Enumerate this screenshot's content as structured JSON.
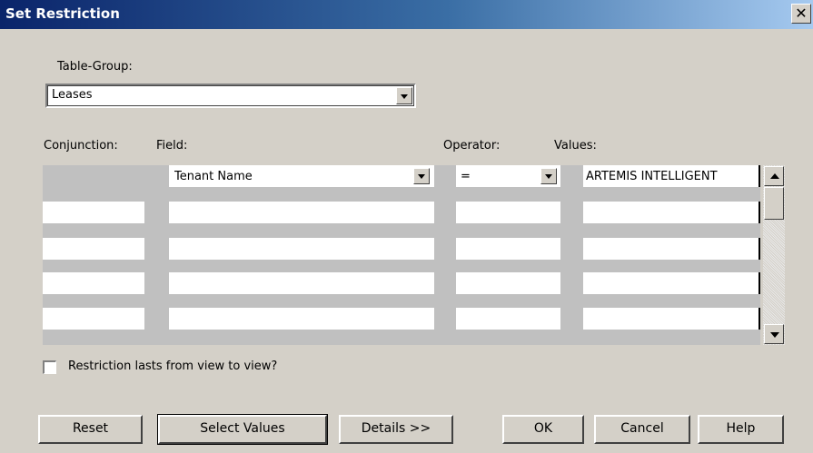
{
  "window": {
    "title": "Set Restriction",
    "close_glyph": "✕"
  },
  "table_group": {
    "label": "Table-Group:",
    "value": "Leases"
  },
  "columns": {
    "conjunction": "Conjunction:",
    "field": "Field:",
    "operator": "Operator:",
    "values": "Values:"
  },
  "rows": [
    {
      "conjunction": "",
      "field": "Tenant Name",
      "operator": "=",
      "value": "ARTEMIS INTELLIGENT"
    },
    {
      "conjunction": "",
      "field": "",
      "operator": "",
      "value": ""
    },
    {
      "conjunction": "",
      "field": "",
      "operator": "",
      "value": ""
    },
    {
      "conjunction": "",
      "field": "",
      "operator": "",
      "value": ""
    },
    {
      "conjunction": "",
      "field": "",
      "operator": "",
      "value": ""
    }
  ],
  "persist": {
    "label": "Restriction lasts from view to view?",
    "checked": false
  },
  "buttons": {
    "reset": "Reset",
    "select_values": "Select Values",
    "details": "Details >>",
    "ok": "OK",
    "cancel": "Cancel",
    "help": "Help"
  }
}
